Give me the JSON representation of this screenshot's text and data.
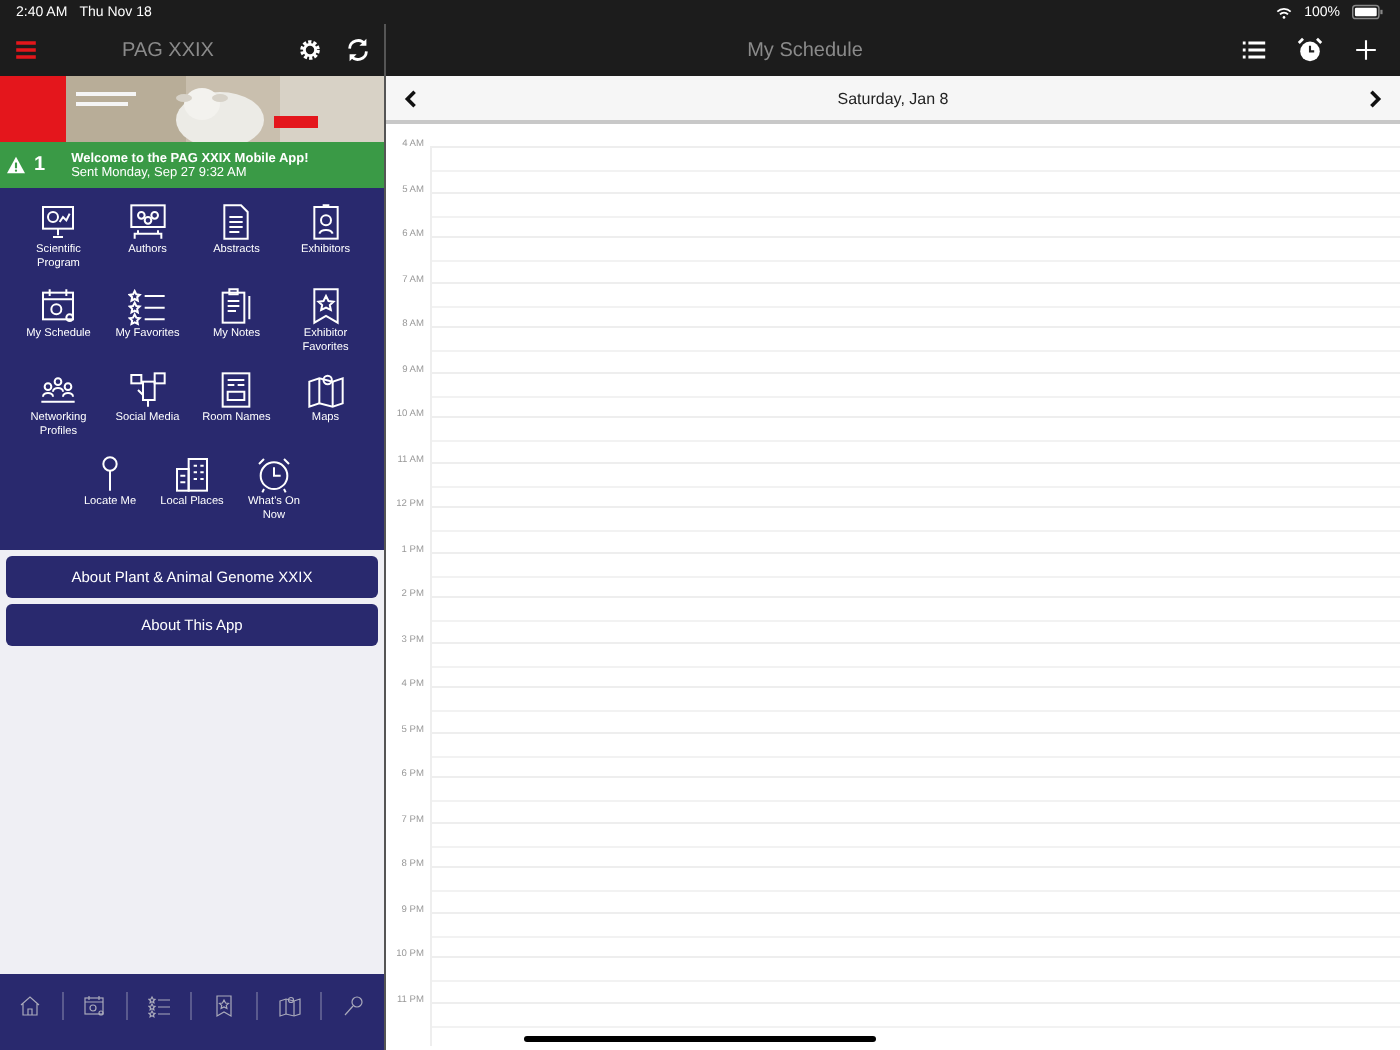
{
  "status_bar": {
    "time": "2:40 AM",
    "date": "Thu Nov 18",
    "battery": "100%"
  },
  "sidebar": {
    "title": "PAG XXIX",
    "notification": {
      "count": "1",
      "title": "Welcome to the PAG XXIX Mobile App!",
      "subtitle": "Sent Monday, Sep 27 9:32 AM"
    },
    "tiles": [
      {
        "label": "Scientific Program"
      },
      {
        "label": "Authors"
      },
      {
        "label": "Abstracts"
      },
      {
        "label": "Exhibitors"
      },
      {
        "label": "My Schedule"
      },
      {
        "label": "My Favorites"
      },
      {
        "label": "My Notes"
      },
      {
        "label": "Exhibitor Favorites"
      },
      {
        "label": "Networking Profiles"
      },
      {
        "label": "Social Media"
      },
      {
        "label": "Room Names"
      },
      {
        "label": "Maps"
      },
      {
        "label": "Locate Me"
      },
      {
        "label": "Local Places"
      },
      {
        "label": "What's On Now"
      }
    ],
    "buttons": [
      "About Plant & Animal Genome XXIX",
      "About This App"
    ]
  },
  "main": {
    "title": "My Schedule",
    "date": "Saturday, Jan 8",
    "hours": [
      "4 AM",
      "5 AM",
      "6 AM",
      "7 AM",
      "8 AM",
      "9 AM",
      "10 AM",
      "11 AM",
      "12 PM",
      "1 PM",
      "2 PM",
      "3 PM",
      "4 PM",
      "5 PM",
      "6 PM",
      "7 PM",
      "8 PM",
      "9 PM",
      "10 PM",
      "11 PM"
    ]
  }
}
